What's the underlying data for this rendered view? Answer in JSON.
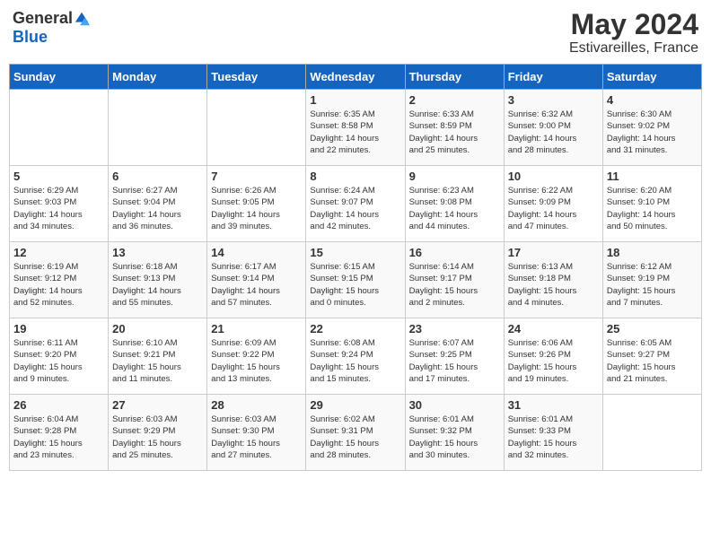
{
  "header": {
    "logo_general": "General",
    "logo_blue": "Blue",
    "month": "May 2024",
    "location": "Estivareilles, France"
  },
  "days_of_week": [
    "Sunday",
    "Monday",
    "Tuesday",
    "Wednesday",
    "Thursday",
    "Friday",
    "Saturday"
  ],
  "weeks": [
    {
      "days": [
        {
          "num": "",
          "info": ""
        },
        {
          "num": "",
          "info": ""
        },
        {
          "num": "",
          "info": ""
        },
        {
          "num": "1",
          "info": "Sunrise: 6:35 AM\nSunset: 8:58 PM\nDaylight: 14 hours\nand 22 minutes."
        },
        {
          "num": "2",
          "info": "Sunrise: 6:33 AM\nSunset: 8:59 PM\nDaylight: 14 hours\nand 25 minutes."
        },
        {
          "num": "3",
          "info": "Sunrise: 6:32 AM\nSunset: 9:00 PM\nDaylight: 14 hours\nand 28 minutes."
        },
        {
          "num": "4",
          "info": "Sunrise: 6:30 AM\nSunset: 9:02 PM\nDaylight: 14 hours\nand 31 minutes."
        }
      ]
    },
    {
      "days": [
        {
          "num": "5",
          "info": "Sunrise: 6:29 AM\nSunset: 9:03 PM\nDaylight: 14 hours\nand 34 minutes."
        },
        {
          "num": "6",
          "info": "Sunrise: 6:27 AM\nSunset: 9:04 PM\nDaylight: 14 hours\nand 36 minutes."
        },
        {
          "num": "7",
          "info": "Sunrise: 6:26 AM\nSunset: 9:05 PM\nDaylight: 14 hours\nand 39 minutes."
        },
        {
          "num": "8",
          "info": "Sunrise: 6:24 AM\nSunset: 9:07 PM\nDaylight: 14 hours\nand 42 minutes."
        },
        {
          "num": "9",
          "info": "Sunrise: 6:23 AM\nSunset: 9:08 PM\nDaylight: 14 hours\nand 44 minutes."
        },
        {
          "num": "10",
          "info": "Sunrise: 6:22 AM\nSunset: 9:09 PM\nDaylight: 14 hours\nand 47 minutes."
        },
        {
          "num": "11",
          "info": "Sunrise: 6:20 AM\nSunset: 9:10 PM\nDaylight: 14 hours\nand 50 minutes."
        }
      ]
    },
    {
      "days": [
        {
          "num": "12",
          "info": "Sunrise: 6:19 AM\nSunset: 9:12 PM\nDaylight: 14 hours\nand 52 minutes."
        },
        {
          "num": "13",
          "info": "Sunrise: 6:18 AM\nSunset: 9:13 PM\nDaylight: 14 hours\nand 55 minutes."
        },
        {
          "num": "14",
          "info": "Sunrise: 6:17 AM\nSunset: 9:14 PM\nDaylight: 14 hours\nand 57 minutes."
        },
        {
          "num": "15",
          "info": "Sunrise: 6:15 AM\nSunset: 9:15 PM\nDaylight: 15 hours\nand 0 minutes."
        },
        {
          "num": "16",
          "info": "Sunrise: 6:14 AM\nSunset: 9:17 PM\nDaylight: 15 hours\nand 2 minutes."
        },
        {
          "num": "17",
          "info": "Sunrise: 6:13 AM\nSunset: 9:18 PM\nDaylight: 15 hours\nand 4 minutes."
        },
        {
          "num": "18",
          "info": "Sunrise: 6:12 AM\nSunset: 9:19 PM\nDaylight: 15 hours\nand 7 minutes."
        }
      ]
    },
    {
      "days": [
        {
          "num": "19",
          "info": "Sunrise: 6:11 AM\nSunset: 9:20 PM\nDaylight: 15 hours\nand 9 minutes."
        },
        {
          "num": "20",
          "info": "Sunrise: 6:10 AM\nSunset: 9:21 PM\nDaylight: 15 hours\nand 11 minutes."
        },
        {
          "num": "21",
          "info": "Sunrise: 6:09 AM\nSunset: 9:22 PM\nDaylight: 15 hours\nand 13 minutes."
        },
        {
          "num": "22",
          "info": "Sunrise: 6:08 AM\nSunset: 9:24 PM\nDaylight: 15 hours\nand 15 minutes."
        },
        {
          "num": "23",
          "info": "Sunrise: 6:07 AM\nSunset: 9:25 PM\nDaylight: 15 hours\nand 17 minutes."
        },
        {
          "num": "24",
          "info": "Sunrise: 6:06 AM\nSunset: 9:26 PM\nDaylight: 15 hours\nand 19 minutes."
        },
        {
          "num": "25",
          "info": "Sunrise: 6:05 AM\nSunset: 9:27 PM\nDaylight: 15 hours\nand 21 minutes."
        }
      ]
    },
    {
      "days": [
        {
          "num": "26",
          "info": "Sunrise: 6:04 AM\nSunset: 9:28 PM\nDaylight: 15 hours\nand 23 minutes."
        },
        {
          "num": "27",
          "info": "Sunrise: 6:03 AM\nSunset: 9:29 PM\nDaylight: 15 hours\nand 25 minutes."
        },
        {
          "num": "28",
          "info": "Sunrise: 6:03 AM\nSunset: 9:30 PM\nDaylight: 15 hours\nand 27 minutes."
        },
        {
          "num": "29",
          "info": "Sunrise: 6:02 AM\nSunset: 9:31 PM\nDaylight: 15 hours\nand 28 minutes."
        },
        {
          "num": "30",
          "info": "Sunrise: 6:01 AM\nSunset: 9:32 PM\nDaylight: 15 hours\nand 30 minutes."
        },
        {
          "num": "31",
          "info": "Sunrise: 6:01 AM\nSunset: 9:33 PM\nDaylight: 15 hours\nand 32 minutes."
        },
        {
          "num": "",
          "info": ""
        }
      ]
    }
  ]
}
